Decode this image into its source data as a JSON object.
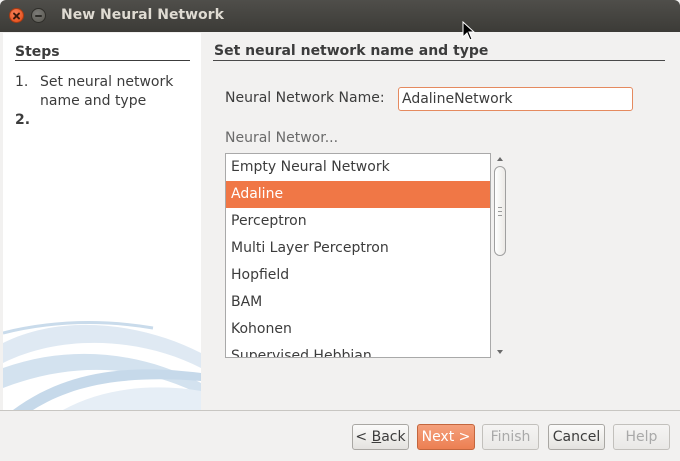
{
  "window": {
    "title": "New Neural Network"
  },
  "steps": {
    "title": "Steps",
    "items": [
      {
        "number": "1.",
        "label": "Set neural network name and type"
      },
      {
        "number": "2.",
        "label": ""
      }
    ]
  },
  "main": {
    "section_title": "Set neural network name and type",
    "name_label": "Neural Network Name:",
    "name_value": "AdalineNetwork",
    "type_label": "Neural Networ...",
    "network_types": [
      "Empty Neural Network",
      "Adaline",
      "Perceptron",
      "Multi Layer Perceptron",
      "Hopfield",
      "BAM",
      "Kohonen",
      "Supervised Hebbian"
    ],
    "selected_type": "Adaline"
  },
  "buttons": {
    "back_prefix": "< ",
    "back_mnemonic": "B",
    "back_rest": "ack",
    "next": "Next >",
    "finish": "Finish",
    "cancel": "Cancel",
    "help": "Help"
  },
  "colors": {
    "accent": "#f07746",
    "titlebar": "#3c3b37"
  }
}
